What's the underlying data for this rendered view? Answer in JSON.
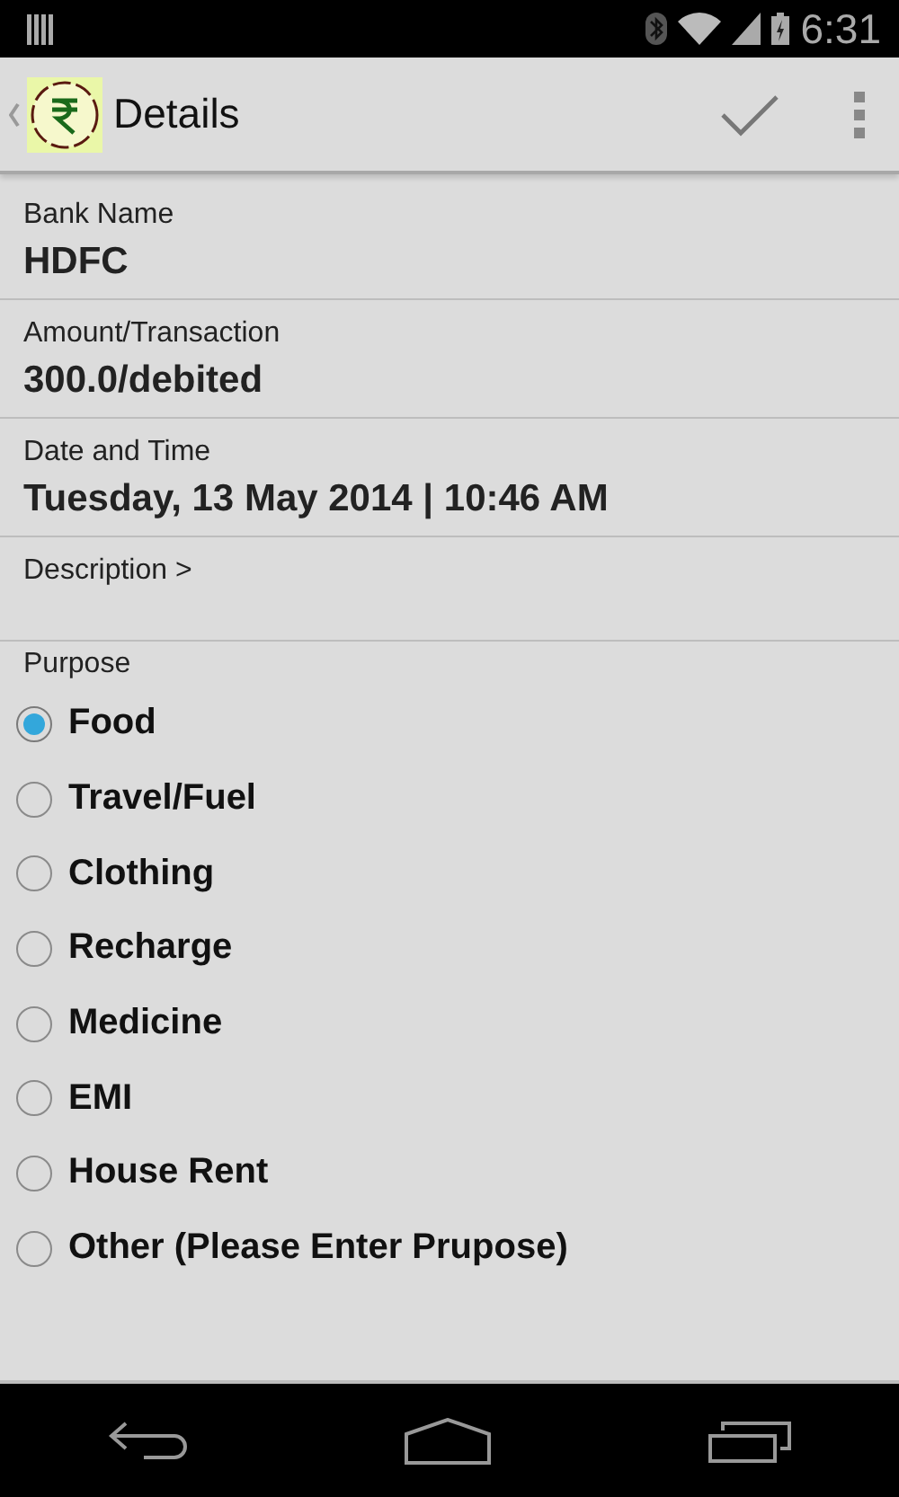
{
  "status_bar": {
    "time": "6:31"
  },
  "action_bar": {
    "title": "Details"
  },
  "fields": [
    {
      "label": "Bank Name",
      "value": "HDFC"
    },
    {
      "label": "Amount/Transaction",
      "value": "300.0/debited"
    },
    {
      "label": "Date and Time",
      "value": "Tuesday, 13 May 2014 | 10:46 AM"
    }
  ],
  "description": {
    "label": "Description >"
  },
  "purpose": {
    "label": "Purpose",
    "options": [
      {
        "label": "Food",
        "selected": true
      },
      {
        "label": "Travel/Fuel",
        "selected": false
      },
      {
        "label": "Clothing",
        "selected": false
      },
      {
        "label": "Recharge",
        "selected": false
      },
      {
        "label": "Medicine",
        "selected": false
      },
      {
        "label": "EMI",
        "selected": false
      },
      {
        "label": "House Rent",
        "selected": false
      },
      {
        "label": "Other (Please Enter Prupose)",
        "selected": false
      }
    ]
  }
}
